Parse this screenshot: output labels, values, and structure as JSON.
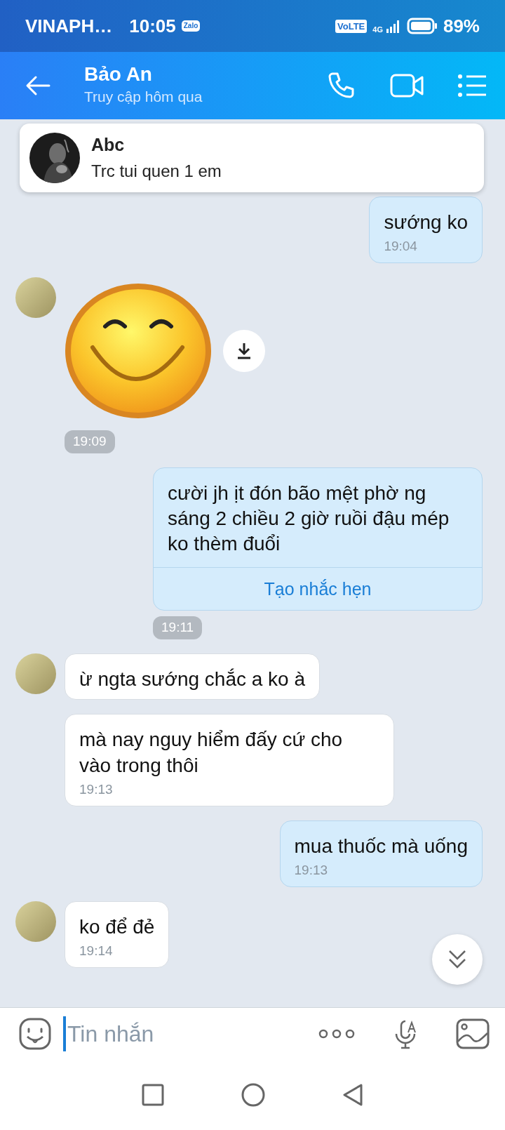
{
  "status_bar": {
    "carrier": "VINAPH…",
    "time": "10:05",
    "app_badge": "Zalo",
    "volte": "VoLTE",
    "network": "4G",
    "battery": "89%"
  },
  "header": {
    "title": "Bảo An",
    "subtitle": "Truy cập hôm qua"
  },
  "notification": {
    "sender": "Abc",
    "text": "Trc tui quen 1 em"
  },
  "messages": [
    {
      "kind": "text",
      "outgoing": true,
      "text": "sướng ko",
      "time": "19:04",
      "time_pill": false
    },
    {
      "kind": "sticker",
      "outgoing": false,
      "avatar": true,
      "time": "19:09",
      "time_pill": true
    },
    {
      "kind": "text",
      "outgoing": true,
      "text": "cười jh ịt đón bão mệt phờ ng sáng 2 chiều 2 giờ ruồi đậu mép ko thèm đuổi",
      "action": "Tạo nhắc hẹn",
      "time": "19:11",
      "time_pill": true
    },
    {
      "kind": "text",
      "outgoing": false,
      "avatar": true,
      "text": "ừ ngta sướng chắc a ko à"
    },
    {
      "kind": "text",
      "outgoing": false,
      "avatar": false,
      "text": "mà nay nguy hiểm đấy cứ cho vào trong thôi",
      "time": "19:13",
      "time_pill": false
    },
    {
      "kind": "text",
      "outgoing": true,
      "text": "mua thuốc mà uống",
      "time": "19:13",
      "time_pill": false
    },
    {
      "kind": "text",
      "outgoing": false,
      "avatar": true,
      "text": "ko để đẻ",
      "time": "19:14",
      "time_pill": false
    }
  ],
  "composer": {
    "placeholder": "Tin nhắn"
  }
}
